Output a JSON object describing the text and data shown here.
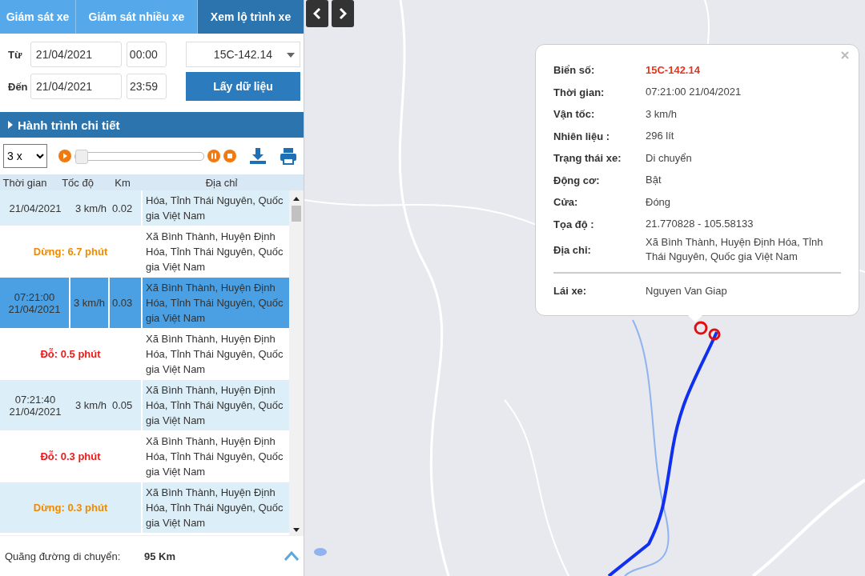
{
  "tabs": [
    {
      "label": "Giám sát xe",
      "selected": false
    },
    {
      "label": "Giám sát nhiều xe",
      "selected": false
    },
    {
      "label": "Xem lộ trình xe",
      "selected": true
    }
  ],
  "form": {
    "from_label": "Từ",
    "from_date": "21/04/2021",
    "from_time": "00:00",
    "to_label": "Đến",
    "to_date": "21/04/2021",
    "to_time": "23:59",
    "vehicle": "15C-142.14",
    "fetch_button": "Lấy dữ liệu"
  },
  "section_title": "Hành trình chi tiết",
  "player": {
    "speed": "3 x",
    "level": 0.0
  },
  "table": {
    "columns": [
      "Thời gian",
      "Tốc độ",
      "Km",
      "Địa chỉ"
    ],
    "rows": [
      {
        "kind": "point",
        "selected": false,
        "time": "21/04/2021",
        "speed": "3 km/h",
        "km": "0.02",
        "address": "Hóa, Tỉnh Thái Nguyên, Quốc gia Việt Nam"
      },
      {
        "kind": "stop",
        "selected": false,
        "status": "Dừng: 6.7 phút",
        "color": "#f08a00",
        "address": "Xã Bình Thành, Huyện Định Hóa, Tỉnh Thái Nguyên, Quốc gia Việt Nam"
      },
      {
        "kind": "point",
        "selected": true,
        "time": "07:21:00 21/04/2021",
        "speed": "3 km/h",
        "km": "0.03",
        "address": "Xã Bình Thành, Huyện Định Hóa, Tỉnh Thái Nguyên, Quốc gia Việt Nam"
      },
      {
        "kind": "stop",
        "selected": false,
        "status": "Đỗ: 0.5 phút",
        "color": "#f01818",
        "address": "Xã Bình Thành, Huyện Định Hóa, Tỉnh Thái Nguyên, Quốc gia Việt Nam"
      },
      {
        "kind": "point",
        "selected": false,
        "time": "07:21:40 21/04/2021",
        "speed": "3 km/h",
        "km": "0.05",
        "address": "Xã Bình Thành, Huyện Định Hóa, Tỉnh Thái Nguyên, Quốc gia Việt Nam"
      },
      {
        "kind": "stop",
        "selected": false,
        "status": "Đỗ: 0.3 phút",
        "color": "#f01818",
        "address": "Xã Bình Thành, Huyện Định Hóa, Tỉnh Thái Nguyên, Quốc gia Việt Nam"
      },
      {
        "kind": "stop",
        "selected": false,
        "status": "Dừng: 0.3 phút",
        "color": "#f08a00",
        "address": "Xã Bình Thành, Huyện Định Hóa, Tỉnh Thái Nguyên, Quốc gia Việt Nam"
      }
    ]
  },
  "footer": {
    "label": "Quãng đường di chuyển:",
    "value": "95 Km"
  },
  "popup": {
    "fields": [
      {
        "label": "Biển số:",
        "value": "15C-142.14",
        "kind": "highlight"
      },
      {
        "label": "Thời gian:",
        "value": "07:21:00 21/04/2021",
        "kind": "plain"
      },
      {
        "label": "Vận tốc:",
        "value": "3 km/h",
        "kind": "plain"
      },
      {
        "label": "Nhiên liệu :",
        "value": "296 lít",
        "kind": "plain"
      },
      {
        "label": "Trạng thái xe:",
        "value": "Di chuyển",
        "kind": "plain"
      },
      {
        "label": "Động cơ:",
        "value": "Bật",
        "kind": "plain"
      },
      {
        "label": "Cửa:",
        "value": "Đóng",
        "kind": "plain"
      },
      {
        "label": "Tọa độ :",
        "value": "21.770828 - 105.58133",
        "kind": "plain"
      },
      {
        "label": "Địa chỉ:",
        "value": "Xã Bình Thành, Huyện Định Hóa, Tỉnh Thái Nguyên, Quốc gia Việt Nam",
        "kind": "plain"
      }
    ],
    "driver": {
      "label": "Lái xe:",
      "value": "Nguyen Van Giap"
    }
  }
}
